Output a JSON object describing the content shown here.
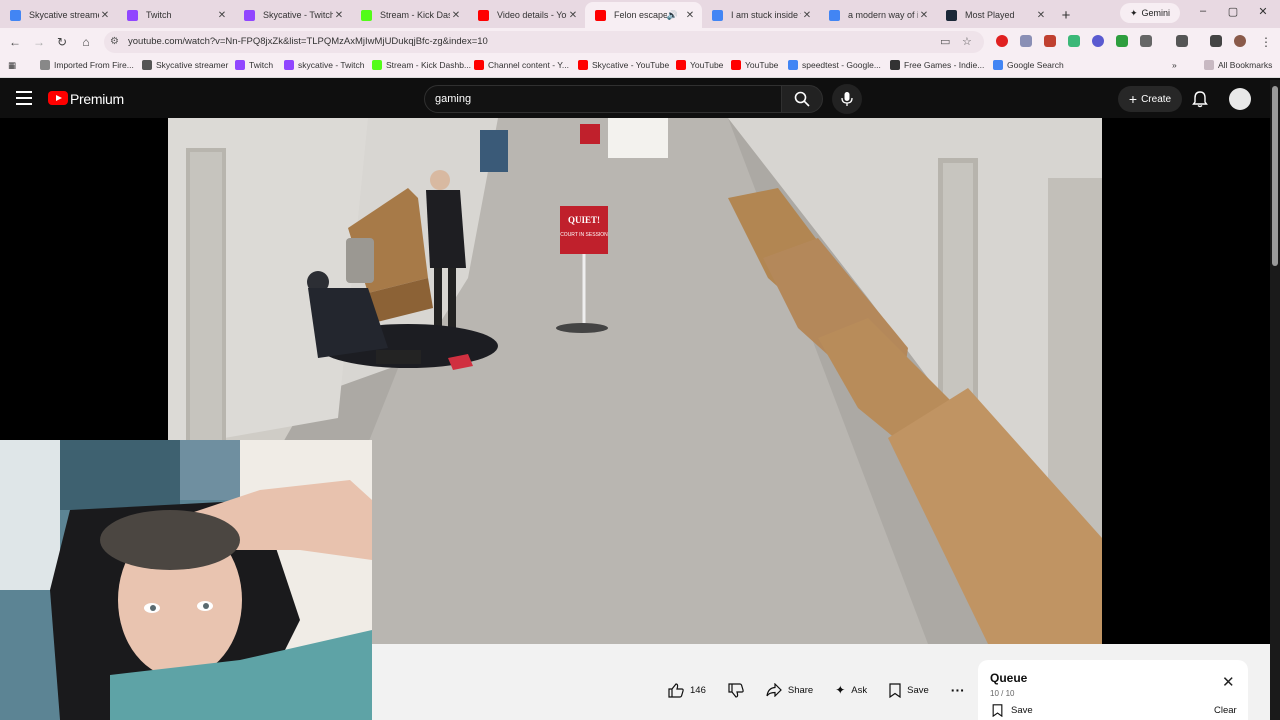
{
  "browser": {
    "tabs": [
      {
        "title": "Skycative streamer",
        "favicon": "google-icon",
        "color": "#4285f4",
        "active": false
      },
      {
        "title": "Twitch",
        "favicon": "twitch-icon",
        "color": "#9146ff",
        "active": false
      },
      {
        "title": "Skycative - Twitch",
        "favicon": "twitch-icon",
        "color": "#9146ff",
        "active": false
      },
      {
        "title": "Stream - Kick Dash",
        "favicon": "kick-icon",
        "color": "#53fc18",
        "active": false
      },
      {
        "title": "Video details - You",
        "favicon": "youtube-studio-icon",
        "color": "#ff0000",
        "active": false
      },
      {
        "title": "Felon escapes F",
        "favicon": "youtube-icon",
        "color": "#ff0000",
        "active": true
      },
      {
        "title": "I am stuck inside th",
        "favicon": "google-icon",
        "color": "#4285f4",
        "active": false
      },
      {
        "title": "a modern way of in",
        "favicon": "google-icon",
        "color": "#4285f4",
        "active": false
      },
      {
        "title": "Most Played",
        "favicon": "steam-icon",
        "color": "#1b2838",
        "active": false
      }
    ],
    "gemini_label": "Gemini",
    "url": "youtube.com/watch?v=Nn-FPQ8jxZk&list=TLPQMzAxMjIwMjUDukqjBfc-zg&index=10",
    "bookmarks": [
      {
        "label": "Imported From Fire...",
        "color": "#888888"
      },
      {
        "label": "Skycative streamer",
        "color": "#555555"
      },
      {
        "label": "Twitch",
        "color": "#9146ff"
      },
      {
        "label": "skycative - Twitch",
        "color": "#9146ff"
      },
      {
        "label": "Stream - Kick Dashb...",
        "color": "#53fc18"
      },
      {
        "label": "Channel content - Y...",
        "color": "#ff0000"
      },
      {
        "label": "Skycative - YouTube",
        "color": "#ff0000"
      },
      {
        "label": "YouTube",
        "color": "#ff0000"
      },
      {
        "label": "YouTube",
        "color": "#ff0000"
      },
      {
        "label": "speedtest - Google...",
        "color": "#4285f4"
      },
      {
        "label": "Free Games - Indie...",
        "color": "#333333"
      },
      {
        "label": "Google Search",
        "color": "#4285f4"
      }
    ],
    "all_bookmarks": "All Bookmarks"
  },
  "youtube": {
    "brand": "Premium",
    "search_value": "gaming",
    "create_label": "Create"
  },
  "video": {
    "sign_text": "QUIET!",
    "sign_sub": "COURT IN SESSION"
  },
  "actions": {
    "likes": "146",
    "share": "Share",
    "ask": "Ask",
    "save": "Save"
  },
  "queue": {
    "title": "Queue",
    "count": "10 / 10",
    "save": "Save",
    "clear": "Clear"
  }
}
